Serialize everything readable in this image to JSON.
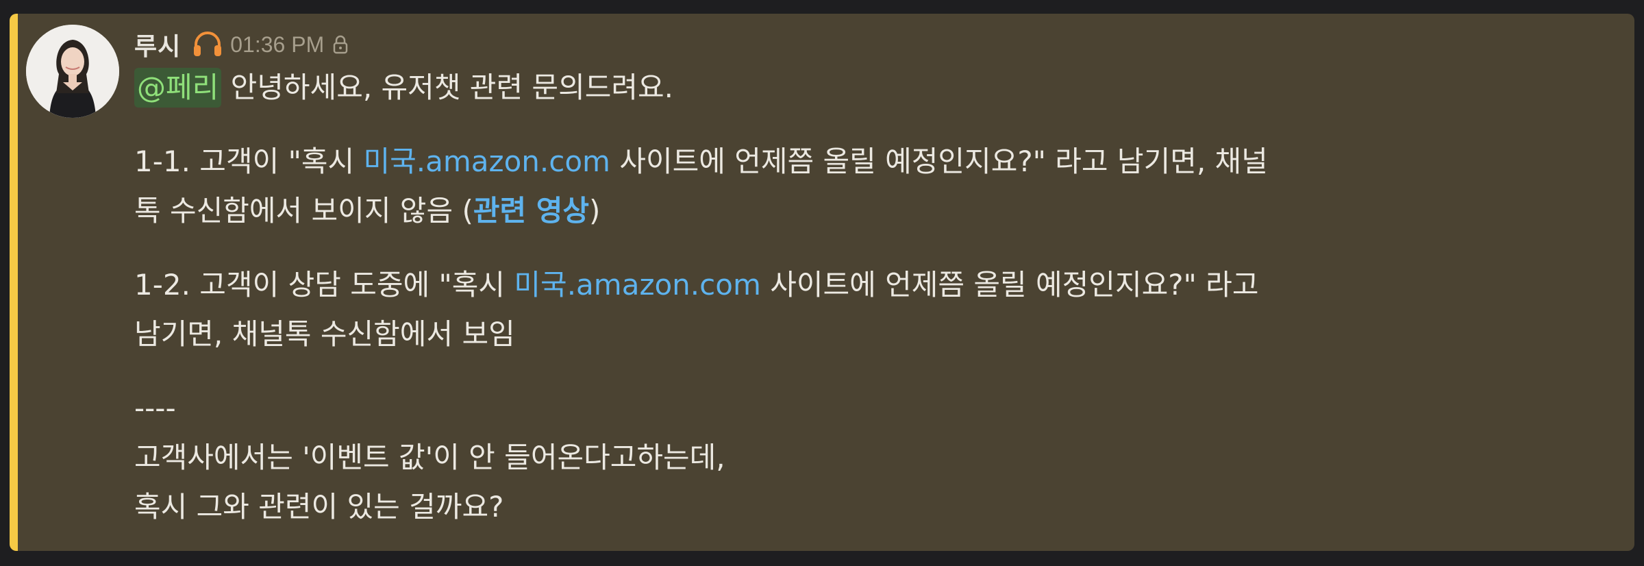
{
  "message": {
    "author": "루시",
    "time": "01:36 PM",
    "icons": {
      "status": "headset-icon",
      "visibility": "lock-icon"
    },
    "colors": {
      "background": "#4b4332",
      "accent_bar": "#f5c945",
      "mention_bg": "#3c5a36",
      "mention_text": "#8fe07a",
      "link": "#5eb3ee"
    },
    "line1": {
      "mention": "@페리",
      "text": " 안녕하세요, 유저챗 관련 문의드려요."
    },
    "para1": {
      "before": "1-1. 고객이 \"혹시 ",
      "link": "미국.amazon.com",
      "after_line1": " 사이트에 언제쯤 올릴 예정인지요?\" 라고 남기면, 채널",
      "line2_before": "톡 수신함에서 보이지 않음 (",
      "video_link": "관련 영상",
      "line2_after": ")"
    },
    "para2": {
      "before": "1-2. 고객이 상담 도중에 \"혹시 ",
      "link": "미국.amazon.com",
      "after_line1": " 사이트에 언제쯤 올릴 예정인지요?\" 라고",
      "line2": "남기면, 채널톡 수신함에서 보임"
    },
    "divider": "----",
    "para3": {
      "line1": "고객사에서는 '이벤트 값'이 안 들어온다고하는데,",
      "line2": "혹시 그와 관련이 있는 걸까요?"
    }
  }
}
